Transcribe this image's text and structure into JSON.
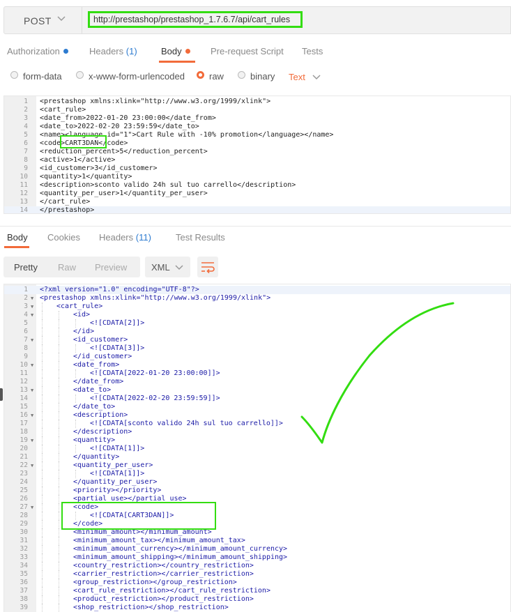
{
  "request": {
    "method": "POST",
    "url": "http://prestashop/prestashop_1.7.6.7/api/cart_rules"
  },
  "request_tabs": [
    {
      "label": "Authorization",
      "count": "",
      "dot": "blue"
    },
    {
      "label": "Headers",
      "count": "(1)",
      "dot": ""
    },
    {
      "label": "Body",
      "count": "",
      "dot": "orange"
    },
    {
      "label": "Pre-request Script",
      "count": "",
      "dot": ""
    },
    {
      "label": "Tests",
      "count": "",
      "dot": ""
    }
  ],
  "body_options": {
    "form_data": "form-data",
    "urlencoded": "x-www-form-urlencoded",
    "raw": "raw",
    "binary": "binary",
    "text_type": "Text"
  },
  "request_body": [
    "<prestashop xmlns:xlink=\"http://www.w3.org/1999/xlink\">",
    "<cart_rule>",
    "<date_from>2022-01-20 23:00:00</date_from>",
    "<date_to>2022-02-20 23:59:59</date_to>",
    "<name><language id=\"1\">Cart Rule with -10% promotion</language></name>",
    "<code>CART3DAN</code>",
    "<reduction_percent>5</reduction_percent>",
    "<active>1</active>",
    "<id_customer>3</id_customer>",
    "<quantity>1</quantity>",
    "<description>sconto valido 24h sul tuo carrello</description>",
    "<quantity_per_user>1</quantity_per_user>",
    "</cart_rule>",
    "</prestashop>"
  ],
  "response_tabs": [
    {
      "label": "Body",
      "count": ""
    },
    {
      "label": "Cookies",
      "count": ""
    },
    {
      "label": "Headers",
      "count": "(11)"
    },
    {
      "label": "Test Results",
      "count": ""
    }
  ],
  "response_toolbar": {
    "pretty": "Pretty",
    "raw": "Raw",
    "preview": "Preview",
    "format": "XML"
  },
  "response_body": [
    {
      "indent": 0,
      "fold": false,
      "text": "<?xml version=\"1.0\" encoding=\"UTF-8\"?>"
    },
    {
      "indent": 0,
      "fold": true,
      "text": "<prestashop xmlns:xlink=\"http://www.w3.org/1999/xlink\">"
    },
    {
      "indent": 1,
      "fold": true,
      "text": "<cart_rule>"
    },
    {
      "indent": 2,
      "fold": true,
      "text": "<id>"
    },
    {
      "indent": 3,
      "fold": false,
      "text": "<![CDATA[2]]>"
    },
    {
      "indent": 2,
      "fold": false,
      "text": "</id>"
    },
    {
      "indent": 2,
      "fold": true,
      "text": "<id_customer>"
    },
    {
      "indent": 3,
      "fold": false,
      "text": "<![CDATA[3]]>"
    },
    {
      "indent": 2,
      "fold": false,
      "text": "</id_customer>"
    },
    {
      "indent": 2,
      "fold": true,
      "text": "<date_from>"
    },
    {
      "indent": 3,
      "fold": false,
      "text": "<![CDATA[2022-01-20 23:00:00]]>"
    },
    {
      "indent": 2,
      "fold": false,
      "text": "</date_from>"
    },
    {
      "indent": 2,
      "fold": true,
      "text": "<date_to>"
    },
    {
      "indent": 3,
      "fold": false,
      "text": "<![CDATA[2022-02-20 23:59:59]]>"
    },
    {
      "indent": 2,
      "fold": false,
      "text": "</date_to>"
    },
    {
      "indent": 2,
      "fold": true,
      "text": "<description>"
    },
    {
      "indent": 3,
      "fold": false,
      "text": "<![CDATA[sconto valido 24h sul tuo carrello]]>"
    },
    {
      "indent": 2,
      "fold": false,
      "text": "</description>"
    },
    {
      "indent": 2,
      "fold": true,
      "text": "<quantity>"
    },
    {
      "indent": 3,
      "fold": false,
      "text": "<![CDATA[1]]>"
    },
    {
      "indent": 2,
      "fold": false,
      "text": "</quantity>"
    },
    {
      "indent": 2,
      "fold": true,
      "text": "<quantity_per_user>"
    },
    {
      "indent": 3,
      "fold": false,
      "text": "<![CDATA[1]]>"
    },
    {
      "indent": 2,
      "fold": false,
      "text": "</quantity_per_user>"
    },
    {
      "indent": 2,
      "fold": false,
      "text": "<priority></priority>"
    },
    {
      "indent": 2,
      "fold": false,
      "text": "<partial_use></partial_use>"
    },
    {
      "indent": 2,
      "fold": true,
      "text": "<code>"
    },
    {
      "indent": 3,
      "fold": false,
      "text": "<![CDATA[CART3DAN]]>"
    },
    {
      "indent": 2,
      "fold": false,
      "text": "</code>"
    },
    {
      "indent": 2,
      "fold": false,
      "text": "<minimum_amount></minimum_amount>"
    },
    {
      "indent": 2,
      "fold": false,
      "text": "<minimum_amount_tax></minimum_amount_tax>"
    },
    {
      "indent": 2,
      "fold": false,
      "text": "<minimum_amount_currency></minimum_amount_currency>"
    },
    {
      "indent": 2,
      "fold": false,
      "text": "<minimum_amount_shipping></minimum_amount_shipping>"
    },
    {
      "indent": 2,
      "fold": false,
      "text": "<country_restriction></country_restriction>"
    },
    {
      "indent": 2,
      "fold": false,
      "text": "<carrier_restriction></carrier_restriction>"
    },
    {
      "indent": 2,
      "fold": false,
      "text": "<group_restriction></group_restriction>"
    },
    {
      "indent": 2,
      "fold": false,
      "text": "<cart_rule_restriction></cart_rule_restriction>"
    },
    {
      "indent": 2,
      "fold": false,
      "text": "<product_restriction></product_restriction>"
    },
    {
      "indent": 2,
      "fold": false,
      "text": "<shop_restriction></shop_restriction>"
    }
  ],
  "colors": {
    "accent": "#f26b3a",
    "link_blue": "#2d7bd0",
    "annotation_green": "#33dd11"
  },
  "icons": {
    "method_dropdown": "chevron-down-icon",
    "text_dropdown": "chevron-down-icon",
    "format_dropdown": "chevron-down-icon",
    "wrap": "wrap-lines-icon",
    "annotation": "checkmark-icon"
  }
}
